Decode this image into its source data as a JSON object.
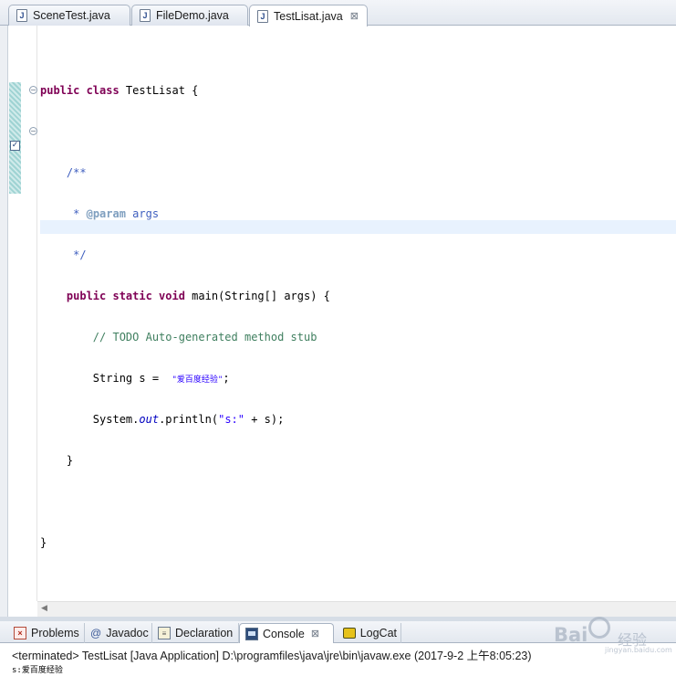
{
  "editor_tabs": [
    {
      "label": "SceneTest.java",
      "icon": "java-file-icon",
      "active": false
    },
    {
      "label": "FileDemo.java",
      "icon": "java-file-icon",
      "active": false
    },
    {
      "label": "TestLisat.java",
      "icon": "java-file-icon",
      "active": true
    }
  ],
  "tab_close_glyph": "⊠",
  "code": {
    "l1_kw": "public class",
    "l1_rest": " TestLisat {",
    "l2": "/**",
    "l3_pre": " * ",
    "l3_tag": "@param",
    "l3_rest": " args",
    "l4": " */",
    "l5_kw": "public static void",
    "l5_rest": " main(String[] args) {",
    "l6": "// TODO Auto-generated method stub",
    "l7_pre": "String s =  ",
    "l7_str": "\"爱百度经验\"",
    "l7_post": ";",
    "l8_pre": "System.",
    "l8_field": "out",
    "l8_mid": ".println(",
    "l8_str": "\"s:\"",
    "l8_post": " + s);",
    "l9": "}",
    "l10": "}"
  },
  "view_tabs": [
    {
      "label": "Problems",
      "icon": "problems-icon"
    },
    {
      "label": "Javadoc",
      "icon": "javadoc-at-icon",
      "glyph": "@"
    },
    {
      "label": "Declaration",
      "icon": "declaration-icon"
    },
    {
      "label": "Console",
      "icon": "console-icon",
      "active": true
    },
    {
      "label": "LogCat",
      "icon": "logcat-icon"
    }
  ],
  "console": {
    "status": "<terminated> TestLisat [Java Application] D:\\programfiles\\java\\jre\\bin\\javaw.exe (2017-9-2 上午8:05:23)",
    "output": "s:爱百度经验"
  },
  "watermark": {
    "brand": "Bai",
    "text": "经验",
    "url": "jingyan.baidu.com"
  }
}
